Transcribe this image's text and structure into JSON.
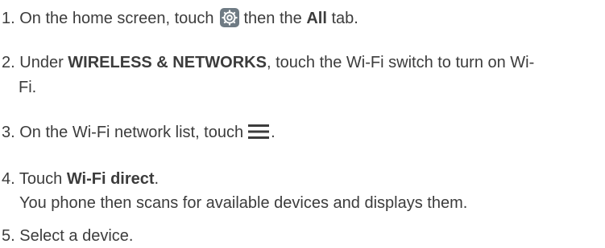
{
  "steps": [
    {
      "number": "1.",
      "text_before": "On the home screen, touch",
      "icon": "settings-gear-icon",
      "text_middle": "then the",
      "bold": "All",
      "text_after": "tab."
    },
    {
      "number": "2.",
      "text_before": "Under",
      "bold": "WIRELESS & NETWORKS",
      "text_after": ", touch the Wi-Fi switch to turn on Wi-",
      "continuation": "Fi."
    },
    {
      "number": "3.",
      "text_before": "On the Wi-Fi network list, touch",
      "icon": "menu-icon",
      "text_after": "."
    },
    {
      "number": "4.",
      "text_before": "Touch",
      "bold": "Wi-Fi direct",
      "text_after": ".",
      "note": "You phone then scans for available devices and displays them."
    },
    {
      "number": "5.",
      "text": "Select a device."
    }
  ],
  "colors": {
    "text": "#3c3c3c",
    "icon_bg": "#6f7b84",
    "menu_icon": "#3c3c3c"
  }
}
